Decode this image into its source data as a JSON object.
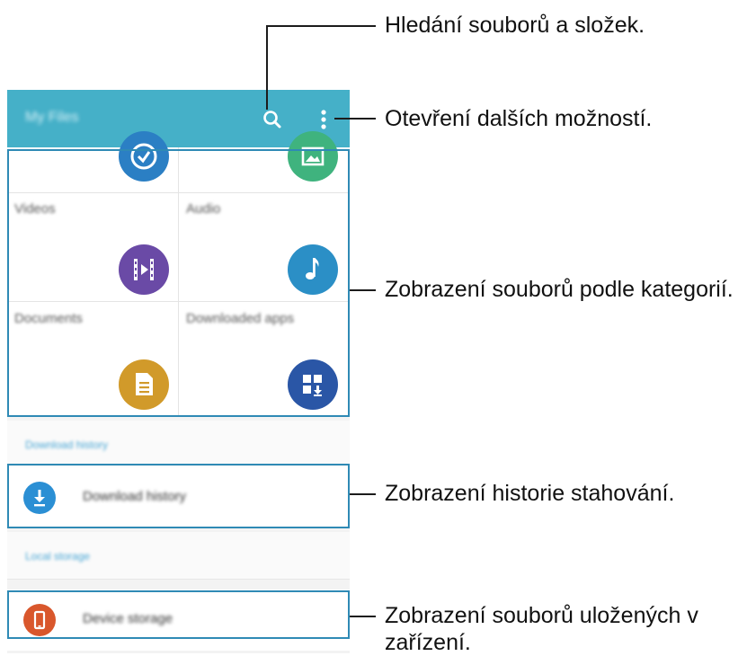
{
  "app": {
    "title": "My Files"
  },
  "categories": [
    {
      "label": "",
      "icon": "clock-icon",
      "color": "#2b7fc4"
    },
    {
      "label": "",
      "icon": "image-icon",
      "color": "#3fb37e"
    },
    {
      "label": "Videos",
      "icon": "video-icon",
      "color": "#6a4aa6"
    },
    {
      "label": "Audio",
      "icon": "music-note-icon",
      "color": "#2b8fc6"
    },
    {
      "label": "Documents",
      "icon": "document-icon",
      "color": "#d19a2a"
    },
    {
      "label": "Downloaded apps",
      "icon": "apps-download-icon",
      "color": "#2a56a6"
    }
  ],
  "sections": {
    "download_history_header": "Download history",
    "download_history_item": "Download history",
    "local_storage_header": "Local storage",
    "device_storage_item": "Device storage"
  },
  "callouts": {
    "search": "Hledání souborů a složek.",
    "more": "Otevření dalších možností.",
    "categories": "Zobrazení souborů podle kategorií.",
    "history": "Zobrazení historie stahování.",
    "device_line1": "Zobrazení souborů uložených v",
    "device_line2": "zařízení."
  },
  "colors": {
    "appbar": "#45b0c8",
    "highlight": "#2f8ab5",
    "download_icon": "#2b8fd4",
    "device_icon": "#d9572c"
  }
}
